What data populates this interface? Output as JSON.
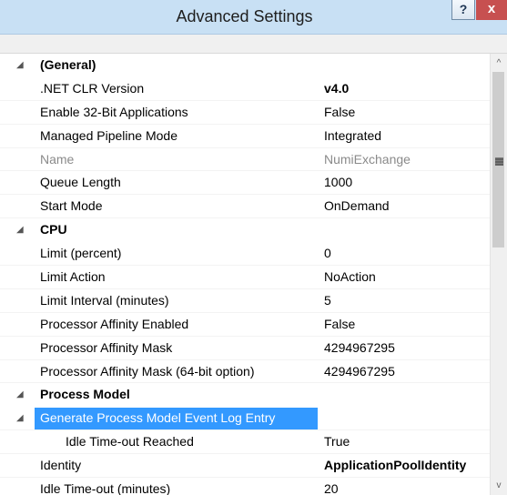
{
  "window": {
    "title": "Advanced Settings",
    "help_label": "?",
    "close_label": "x"
  },
  "grid": {
    "rows": [
      {
        "type": "category",
        "expand": "◢",
        "name": "(General)"
      },
      {
        "type": "prop",
        "name": ".NET CLR Version",
        "value": "v4.0",
        "value_bold": true
      },
      {
        "type": "prop",
        "name": "Enable 32-Bit Applications",
        "value": "False"
      },
      {
        "type": "prop",
        "name": "Managed Pipeline Mode",
        "value": "Integrated"
      },
      {
        "type": "prop",
        "name": "Name",
        "value": "NumiExchange",
        "disabled": true
      },
      {
        "type": "prop",
        "name": "Queue Length",
        "value": "1000"
      },
      {
        "type": "prop",
        "name": "Start Mode",
        "value": "OnDemand"
      },
      {
        "type": "category",
        "expand": "◢",
        "name": "CPU"
      },
      {
        "type": "prop",
        "name": "Limit (percent)",
        "value": "0"
      },
      {
        "type": "prop",
        "name": "Limit Action",
        "value": "NoAction"
      },
      {
        "type": "prop",
        "name": "Limit Interval (minutes)",
        "value": "5"
      },
      {
        "type": "prop",
        "name": "Processor Affinity Enabled",
        "value": "False"
      },
      {
        "type": "prop",
        "name": "Processor Affinity Mask",
        "value": "4294967295"
      },
      {
        "type": "prop",
        "name": "Processor Affinity Mask (64-bit option)",
        "value": "4294967295"
      },
      {
        "type": "category",
        "expand": "◢",
        "name": "Process Model"
      },
      {
        "type": "prop",
        "name": "Generate Process Model Event Log Entry",
        "value": "",
        "selected": true,
        "expand": "◢"
      },
      {
        "type": "prop",
        "name": "Idle Time-out Reached",
        "value": "True",
        "indented": true
      },
      {
        "type": "prop",
        "name": "Identity",
        "value": "ApplicationPoolIdentity",
        "value_bold": true
      },
      {
        "type": "prop",
        "name": "Idle Time-out (minutes)",
        "value": "20"
      }
    ]
  },
  "scrollbar": {
    "up_arrow": "^",
    "down_arrow": "v",
    "position_fraction": 0
  },
  "colors": {
    "titlebar": "#c8e0f4",
    "selection": "#3399ff",
    "close_button": "#c75050"
  }
}
